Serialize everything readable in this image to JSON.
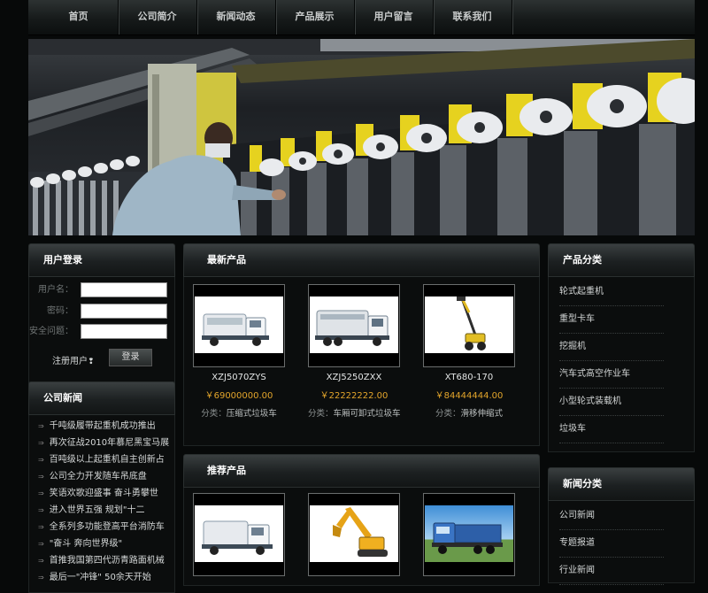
{
  "nav": {
    "items": [
      "首页",
      "公司简介",
      "新闻动态",
      "产品展示",
      "用户留言",
      "联系我们"
    ]
  },
  "login": {
    "title": "用户登录",
    "username_label": "用户名：",
    "password_label": "密码：",
    "question_label": "安全问题：",
    "register_text": "注册用户",
    "login_button": "登录"
  },
  "company_news": {
    "title": "公司新闻",
    "items": [
      "千吨级履带起重机成功推出",
      "再次征战2010年慕尼黑宝马展",
      "百吨级以上起重机自主创新占",
      "公司全力开发随车吊底盘",
      "笑语欢歌迎盛事 奋斗勇攀世",
      "进入世界五强 规划\"十二",
      "全系列多功能登高平台消防车",
      "\"奋斗 奔向世界级\"",
      "首推我国第四代沥青路面机械",
      "最后一\"冲锋\" 50余天开始"
    ]
  },
  "latest_products": {
    "title": "最新产品",
    "cat_prefix": "分类：",
    "items": [
      {
        "name": "XZJ5070ZYS",
        "price": "￥69000000.00",
        "category": "压缩式垃圾车",
        "icon": "garbage-truck-icon"
      },
      {
        "name": "XZJ5250ZXX",
        "price": "￥22222222.00",
        "category": "车厢可卸式垃圾车",
        "icon": "garbage-truck-icon"
      },
      {
        "name": "XT680-170",
        "price": "￥84444444.00",
        "category": "滑移伸缩式",
        "icon": "telescopic-handler-icon"
      }
    ]
  },
  "recommended_products": {
    "title": "推荐产品",
    "items": [
      {
        "icon": "garbage-truck-icon"
      },
      {
        "icon": "excavator-icon"
      },
      {
        "icon": "cargo-truck-icon"
      }
    ]
  },
  "product_categories": {
    "title": "产品分类",
    "items": [
      "轮式起重机",
      "重型卡车",
      "挖掘机",
      "汽车式高空作业车",
      "小型轮式装载机",
      "垃圾车"
    ]
  },
  "news_categories": {
    "title": "新闻分类",
    "items": [
      "公司新闻",
      "专题报道",
      "行业新闻"
    ]
  },
  "colors": {
    "price": "#e3a52b",
    "background": "#070909",
    "panel_head": "#2a2f30"
  }
}
